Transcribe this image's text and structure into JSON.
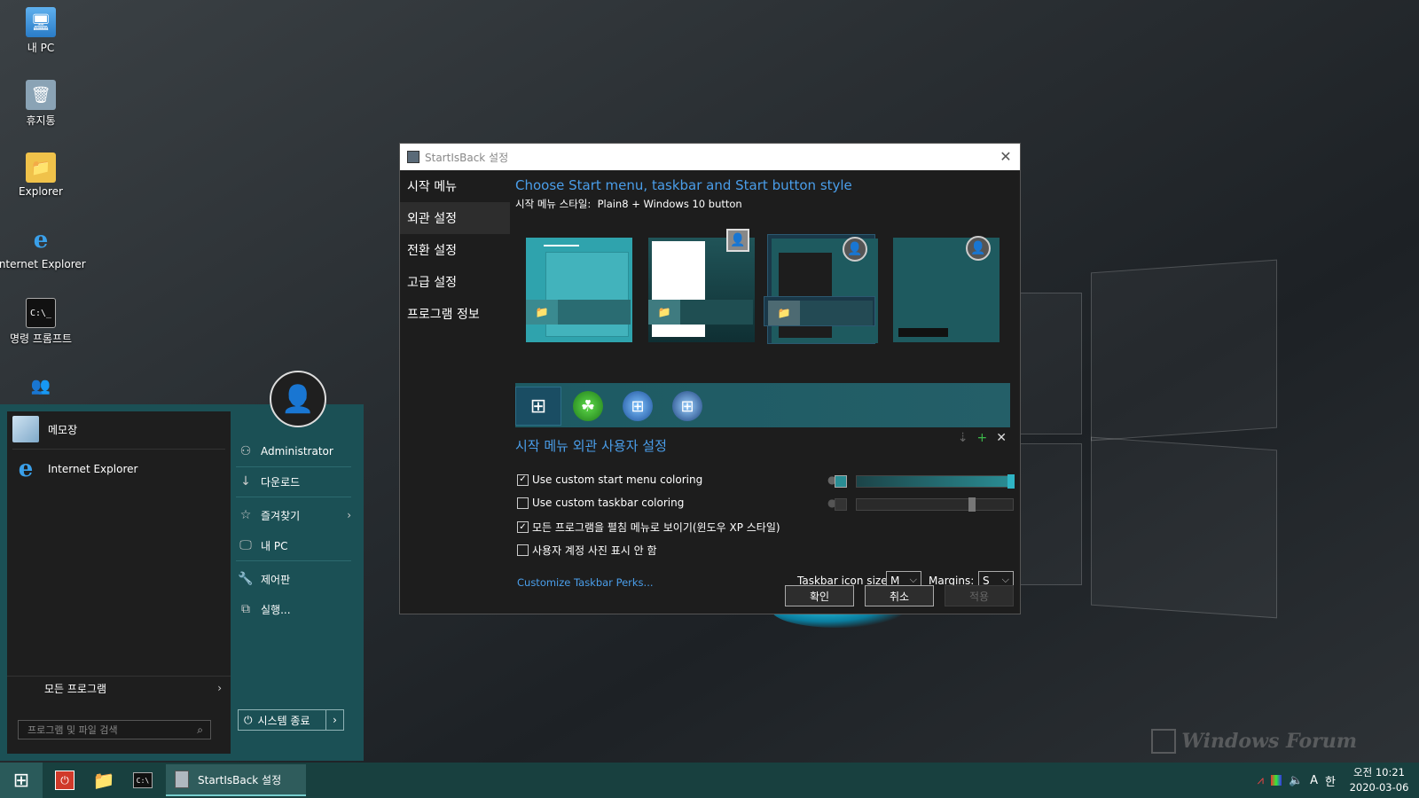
{
  "desktop": {
    "icons": [
      {
        "label": "내 PC",
        "icon": "computer-icon"
      },
      {
        "label": "휴지통",
        "icon": "recycle-bin-icon"
      },
      {
        "label": "Explorer",
        "icon": "folder-icon"
      },
      {
        "label": "Internet Explorer",
        "icon": "ie-icon"
      },
      {
        "label": "명령 프롬프트",
        "icon": "cmd-icon"
      },
      {
        "label": "",
        "icon": "users-icon"
      }
    ],
    "watermark": "Windows Forum"
  },
  "start_menu": {
    "pinned": [
      {
        "label": "메모장",
        "icon": "notepad-icon"
      },
      {
        "label": "Internet Explorer",
        "icon": "ie-icon"
      }
    ],
    "all_programs": "모든 프로그램",
    "search_placeholder": "프로그램 및 파일 검색",
    "right_items": [
      {
        "label": "Administrator",
        "icon": "user-icon"
      },
      {
        "label": "다운로드",
        "icon": "download-icon"
      },
      {
        "label": "즐겨찾기",
        "icon": "star-icon"
      },
      {
        "label": "내 PC",
        "icon": "computer-icon"
      },
      {
        "label": "제어판",
        "icon": "wrench-icon"
      },
      {
        "label": "실행...",
        "icon": "run-icon"
      }
    ],
    "power_label": "시스템 종료"
  },
  "dialog": {
    "title": "StartIsBack 설정",
    "nav": [
      "시작 메뉴",
      "외관 설정",
      "전환 설정",
      "고급 설정",
      "프로그램 정보"
    ],
    "active_nav": 1,
    "heading": "Choose Start menu, taskbar and Start button style",
    "style_label": "시작 메뉴 스타일:",
    "style_value": "Plain8 + Windows 10 button",
    "selected_style": 2,
    "custom_heading": "시작 메뉴 외관 사용자 설정",
    "options": [
      {
        "label": "Use custom start menu coloring",
        "checked": true
      },
      {
        "label": "Use custom taskbar coloring",
        "checked": false
      },
      {
        "label": "모든 프로그램을 펼침 메뉴로 보이기(윈도우 XP 스타일)",
        "checked": true
      },
      {
        "label": "사용자 계정 사진 표시 안 함",
        "checked": false
      }
    ],
    "link": "Customize Taskbar Perks...",
    "icon_size_label": "Taskbar icon size:",
    "icon_size_value": "M",
    "margins_label": "Margins:",
    "margins_value": "S",
    "ok": "확인",
    "cancel": "취소",
    "apply": "적용",
    "colors": {
      "accent": "#4a9eea",
      "teal": "#2a8d94"
    }
  },
  "taskbar": {
    "app_label": "StartIsBack 설정",
    "ime": "A",
    "lang": "한",
    "time": "오전 10:21",
    "date": "2020-03-06"
  }
}
